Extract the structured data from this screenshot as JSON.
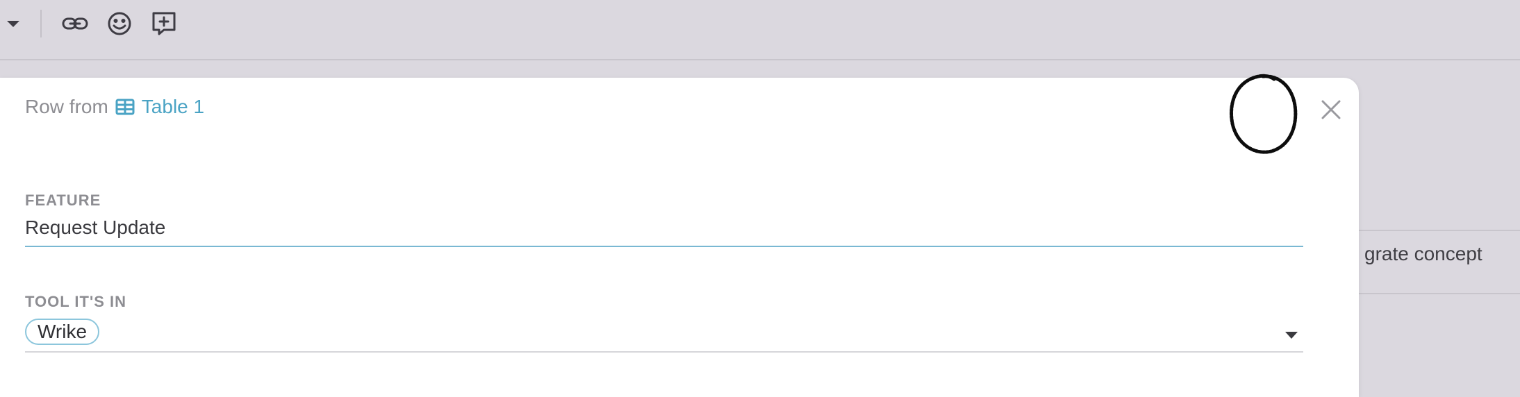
{
  "toolbar": {
    "icons": [
      "caret-down-icon",
      "link-icon",
      "emoji-icon",
      "add-comment-icon"
    ]
  },
  "background": {
    "cell_text": "grate concept"
  },
  "panel": {
    "breadcrumb_prefix": "Row from",
    "table_name": "Table 1",
    "fields": {
      "feature": {
        "label": "FEATURE",
        "value": "Request Update"
      },
      "tool": {
        "label": "TOOL IT'S IN",
        "value": "Wrike"
      }
    }
  },
  "colors": {
    "link": "#4aa3c4",
    "tag_border": "#8cc6dc",
    "active_underline": "#7ab8d3",
    "background": "#dbd8df"
  }
}
